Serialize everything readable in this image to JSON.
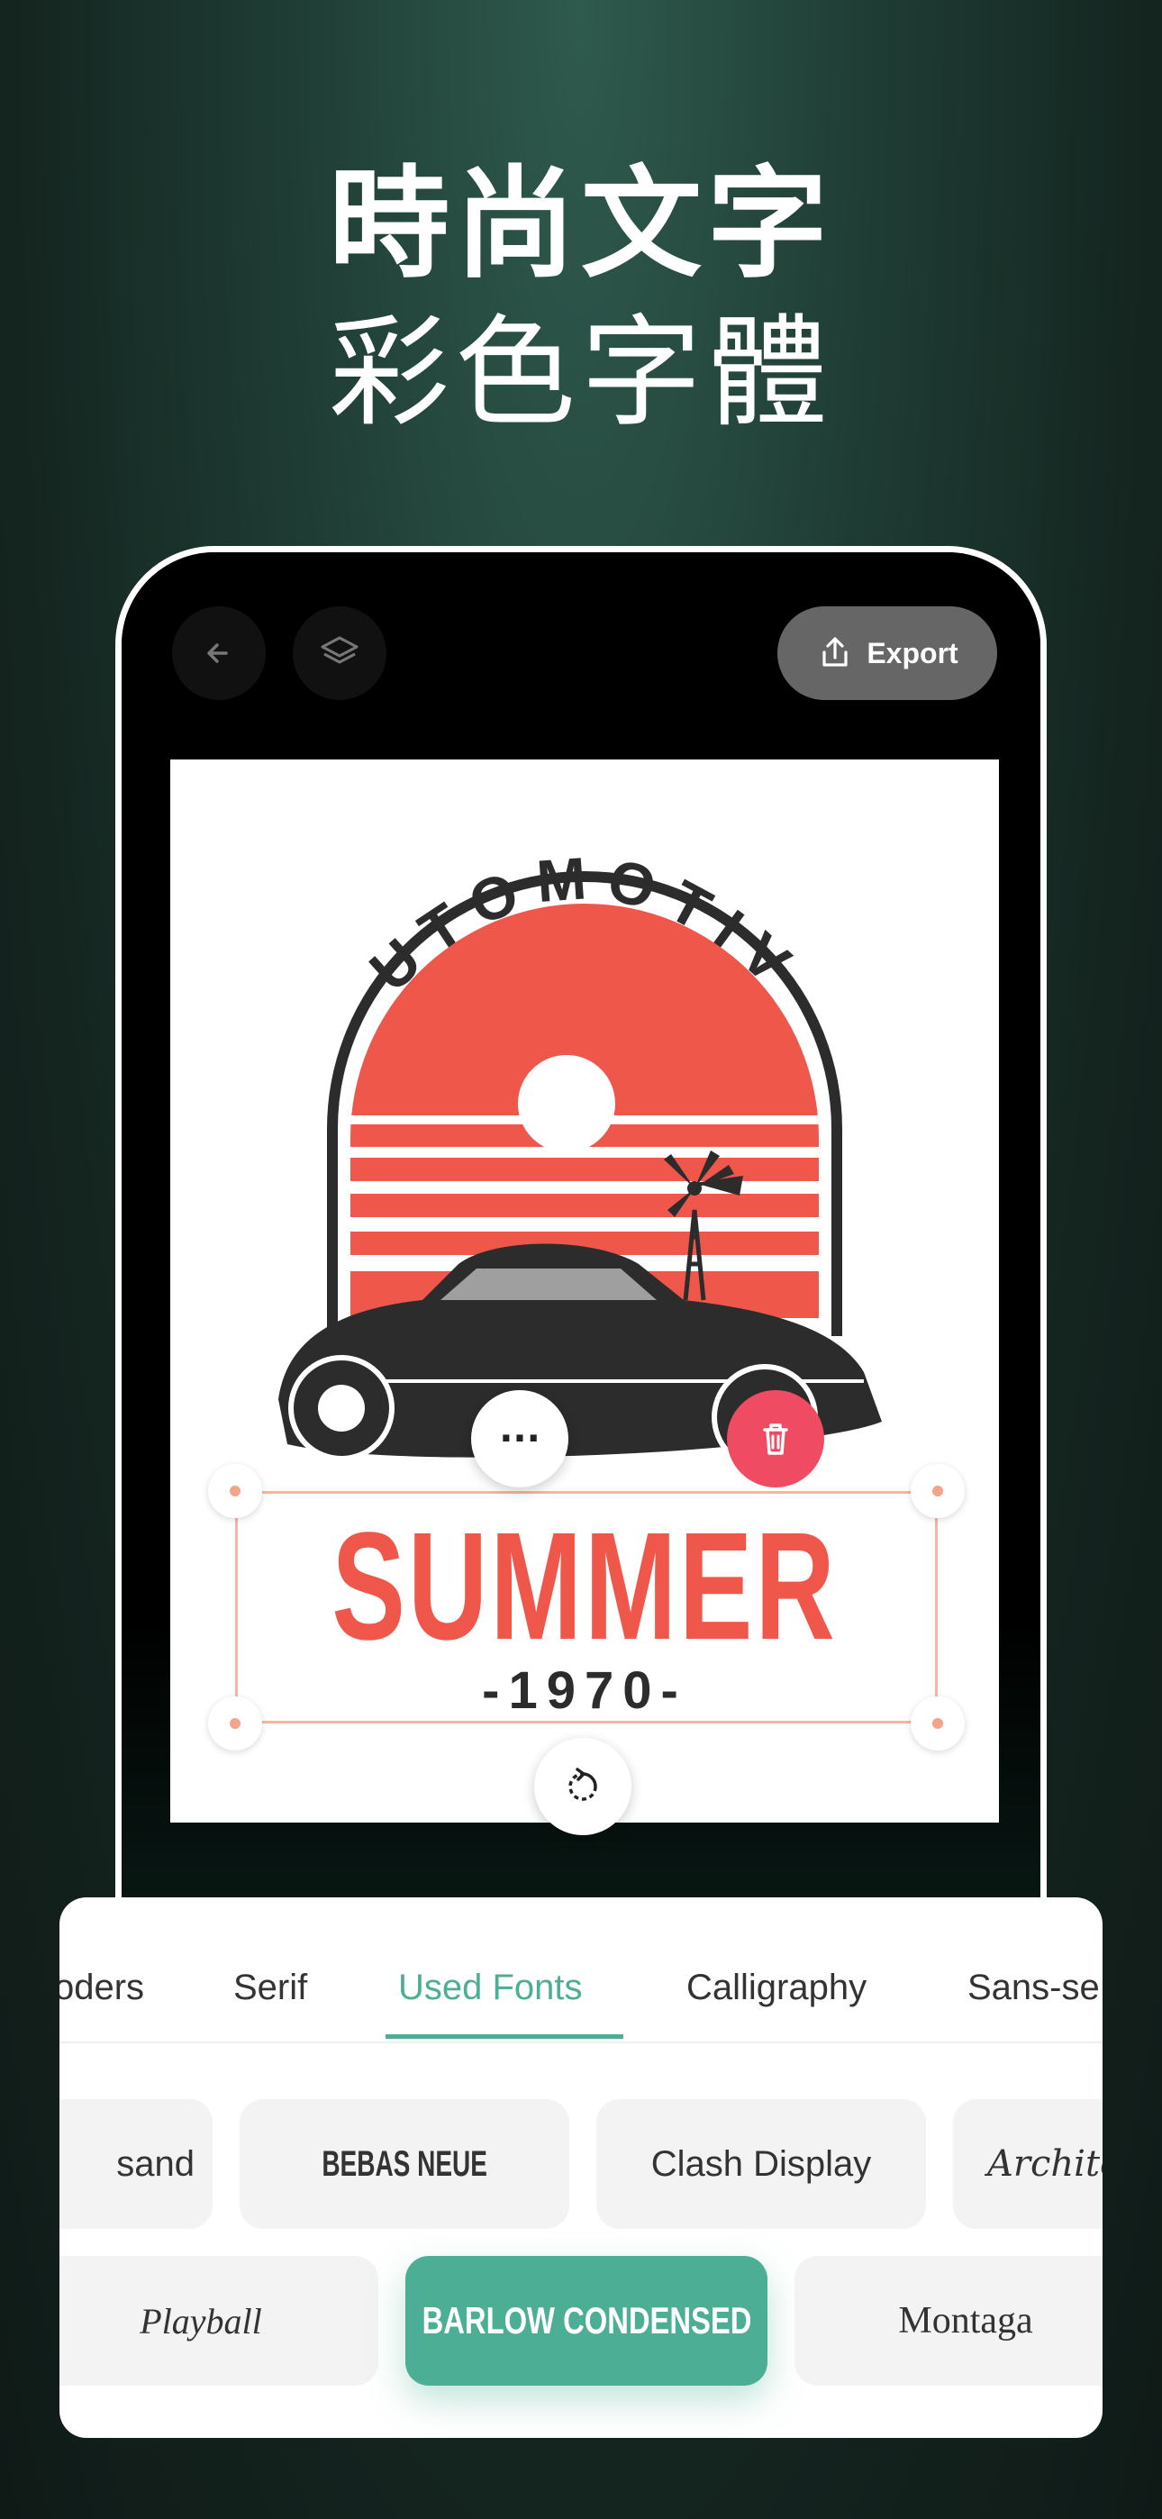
{
  "headline": {
    "line1": "時尚文字",
    "line2": "彩色字體"
  },
  "toolbar": {
    "export_label": "Export",
    "back_icon": "back-arrow-icon",
    "layers_icon": "layers-icon",
    "export_icon": "share-icon"
  },
  "canvas": {
    "arc_text": "AUTOMOTIVE",
    "headline": "SUMMER",
    "year": "-1970-",
    "colors": {
      "accent": "#f0574b",
      "dark": "#2c2c2c"
    }
  },
  "controls": {
    "more": "···"
  },
  "font_panel": {
    "tabs": [
      "oders",
      "Serif",
      "Used Fonts",
      "Calligraphy",
      "Sans-se"
    ],
    "active_tab": "Used Fonts",
    "row1": [
      "sand",
      "BEBAS NEUE",
      "Clash Display",
      "Archite"
    ],
    "row2": [
      "Playball",
      "BARLOW CONDENSED",
      "Montaga"
    ],
    "selected_font": "BARLOW CONDENSED",
    "accent_color": "#4caf95"
  }
}
